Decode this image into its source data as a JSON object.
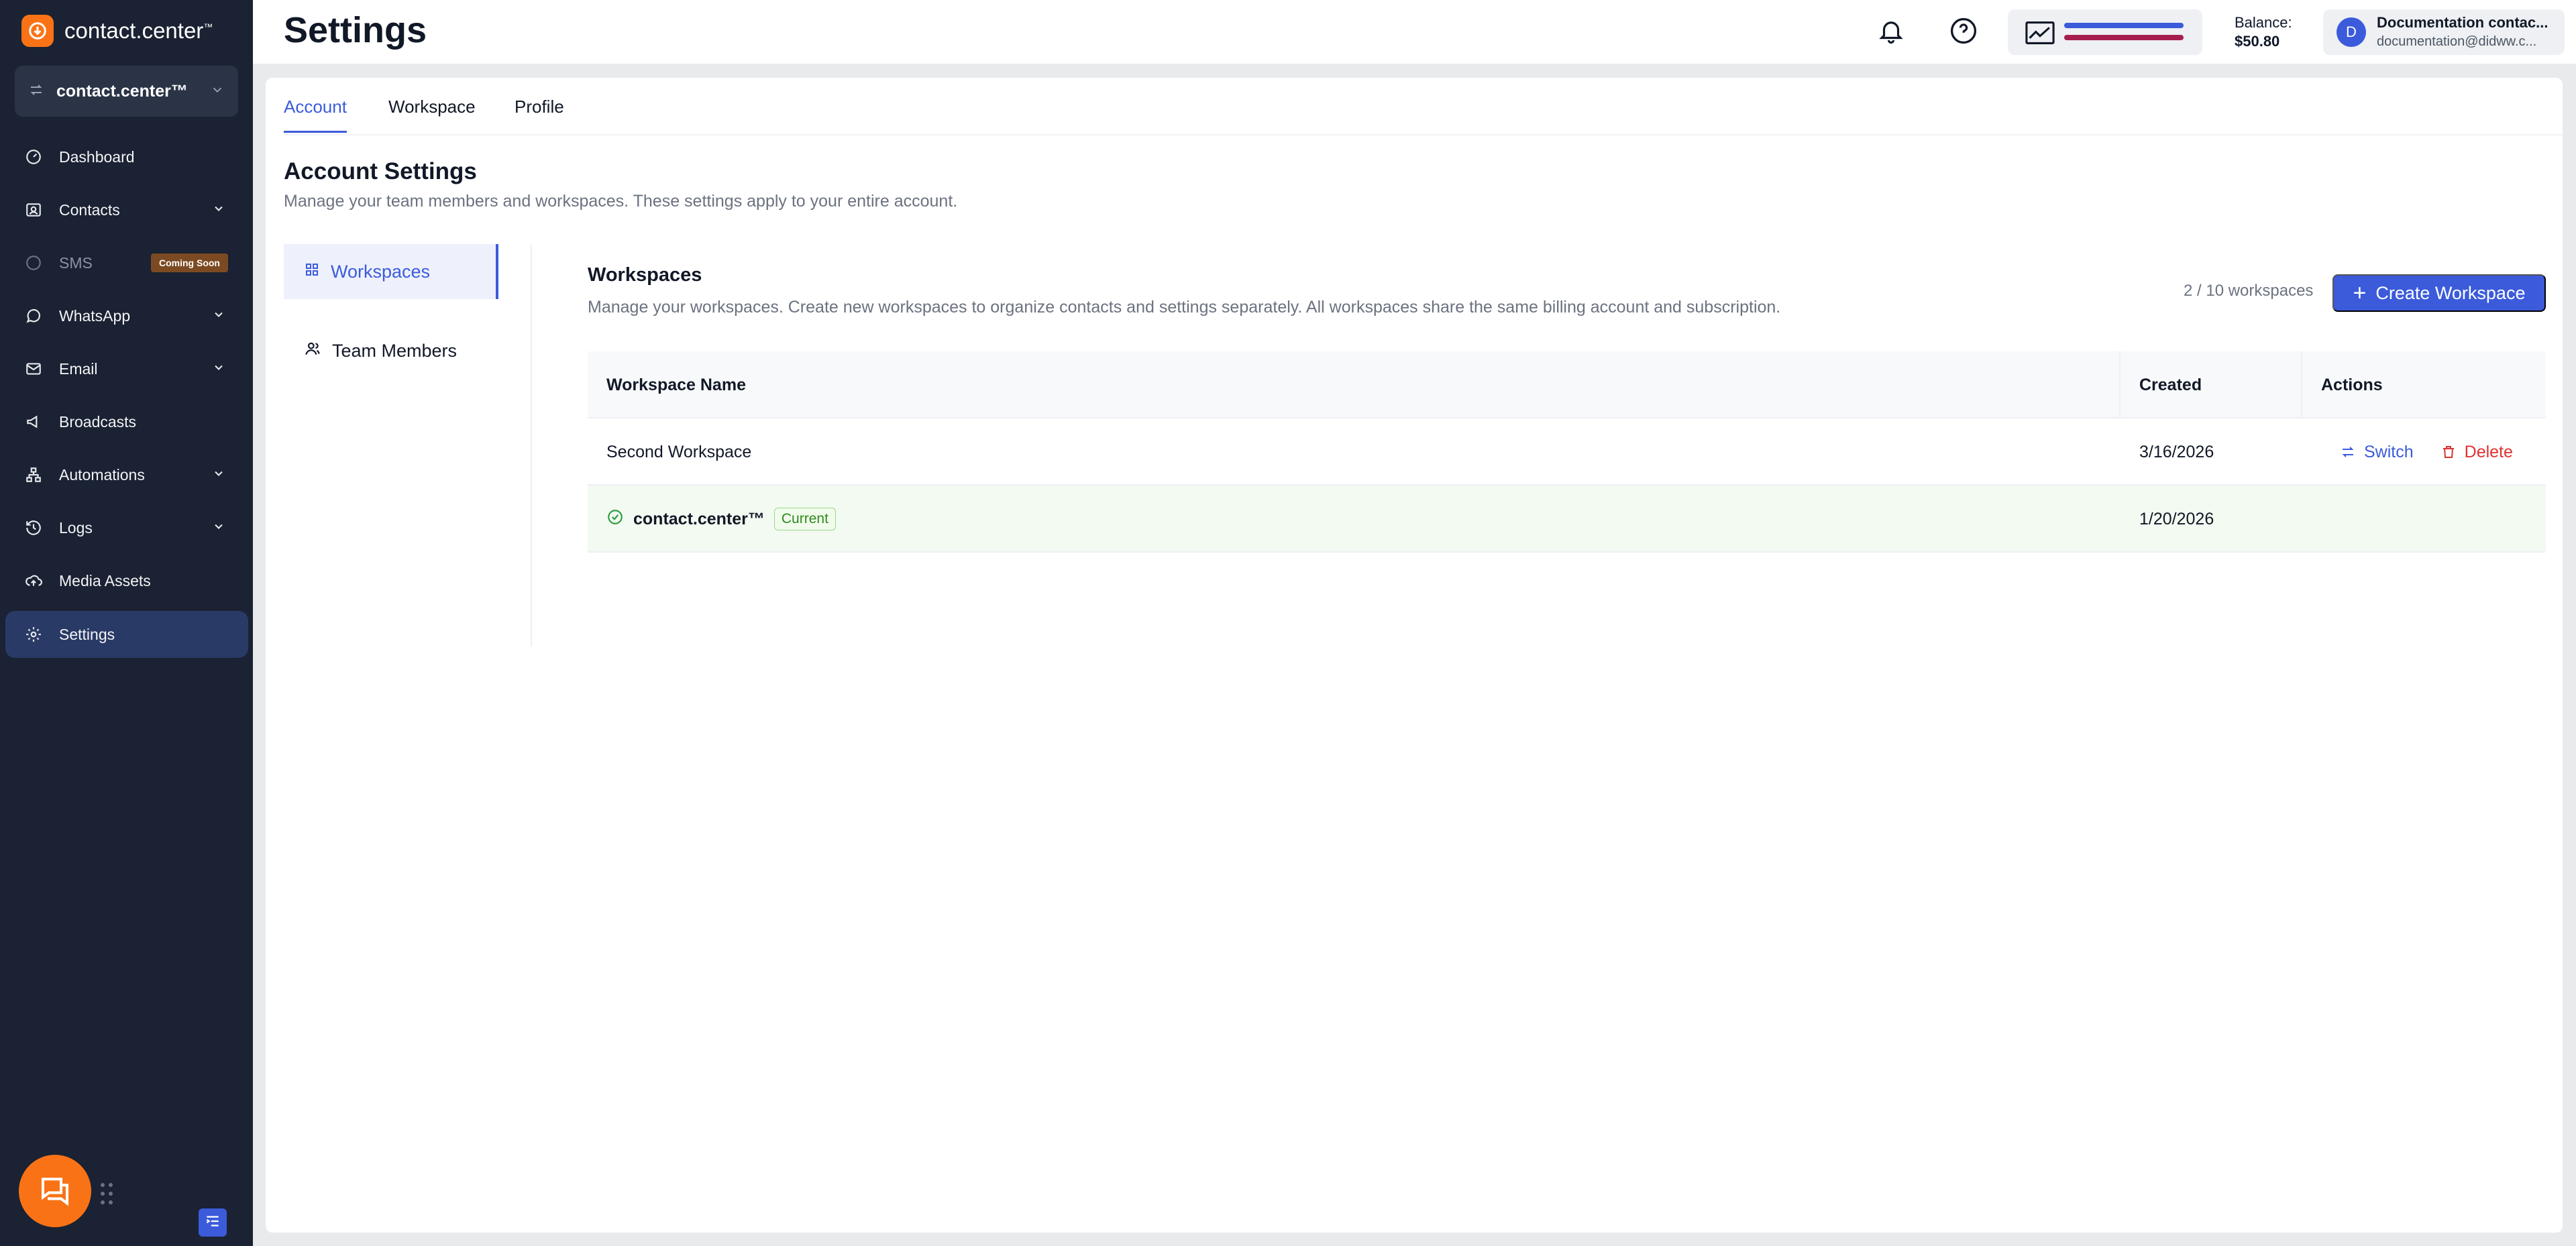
{
  "app": {
    "logo_text": "contact.center",
    "logo_tm": "™"
  },
  "workspace_switcher": {
    "name": "contact.center™"
  },
  "sidebar": {
    "items": [
      {
        "label": "Dashboard"
      },
      {
        "label": "Contacts"
      },
      {
        "label": "SMS",
        "badge": "Coming Soon"
      },
      {
        "label": "WhatsApp"
      },
      {
        "label": "Email"
      },
      {
        "label": "Broadcasts"
      },
      {
        "label": "Automations"
      },
      {
        "label": "Logs"
      },
      {
        "label": "Media Assets"
      },
      {
        "label": "Settings"
      }
    ]
  },
  "header": {
    "title": "Settings",
    "balance_label": "Balance:",
    "balance_value": "$50.80",
    "account_initial": "D",
    "account_name": "Documentation contac...",
    "account_email": "documentation@didww.c..."
  },
  "tabs": [
    {
      "label": "Account"
    },
    {
      "label": "Workspace"
    },
    {
      "label": "Profile"
    }
  ],
  "account_settings": {
    "title": "Account Settings",
    "description": "Manage your team members and workspaces. These settings apply to your entire account."
  },
  "subnav": [
    {
      "label": "Workspaces"
    },
    {
      "label": "Team Members"
    }
  ],
  "workspaces_panel": {
    "title": "Workspaces",
    "description": "Manage your workspaces. Create new workspaces to organize contacts and settings separately. All workspaces share the same billing account and subscription.",
    "count": "2 / 10 workspaces",
    "create_label": "Create Workspace"
  },
  "table": {
    "columns": [
      "Workspace Name",
      "Created",
      "Actions"
    ],
    "rows": [
      {
        "name": "Second Workspace",
        "created": "3/16/2026",
        "switch_label": "Switch",
        "delete_label": "Delete"
      },
      {
        "name": "contact.center™",
        "badge": "Current",
        "created": "1/20/2026"
      }
    ]
  },
  "colors": {
    "sidebar_bg": "#1a2233",
    "accent": "#3b5bdb",
    "brand_orange": "#f97316",
    "danger": "#e03131",
    "success": "#2f8a1f"
  }
}
